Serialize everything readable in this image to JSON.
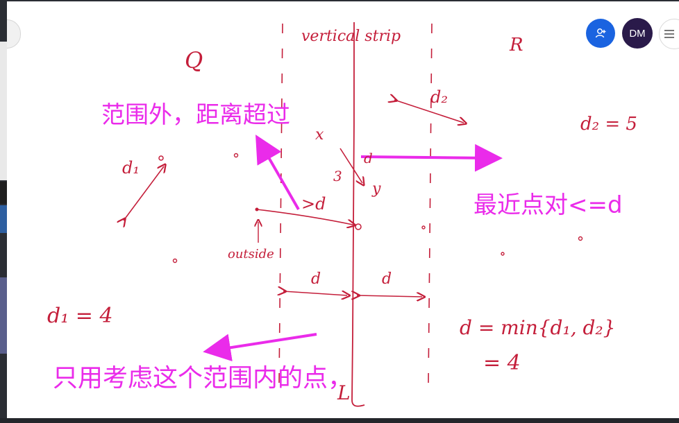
{
  "controls": {
    "avatar_initials": "DM",
    "add_person_icon": "add-person-icon",
    "menu_icon": "hamburger-menu-icon",
    "add_person_color": "#1a63e0",
    "avatar_color": "#2a1a4a"
  },
  "annotations": {
    "outside_range": "范围外，距离超过",
    "closest_pair": "最近点对<=d",
    "only_consider": "只用考虑这个范围内的点，"
  },
  "handwriting": {
    "strip_title": "vertical strip",
    "left_set": "Q",
    "right_set": "R",
    "d1_label": "d₁",
    "d2_label": "d₂",
    "d2_value": "d₂ = 5",
    "d1_value": "d₁ = 4",
    "x_label": "x",
    "y_label": "y",
    "three": "3",
    "d_small": "d",
    "gt_d": ">d",
    "outside": "outside",
    "d_left": "d",
    "d_right": "d",
    "d_min": "d = min{d₁, d₂}",
    "equals_four": "= 4",
    "l_label": "L"
  },
  "colors": {
    "ink_red": "#c41e3a",
    "highlight_magenta": "#ea2bea"
  }
}
